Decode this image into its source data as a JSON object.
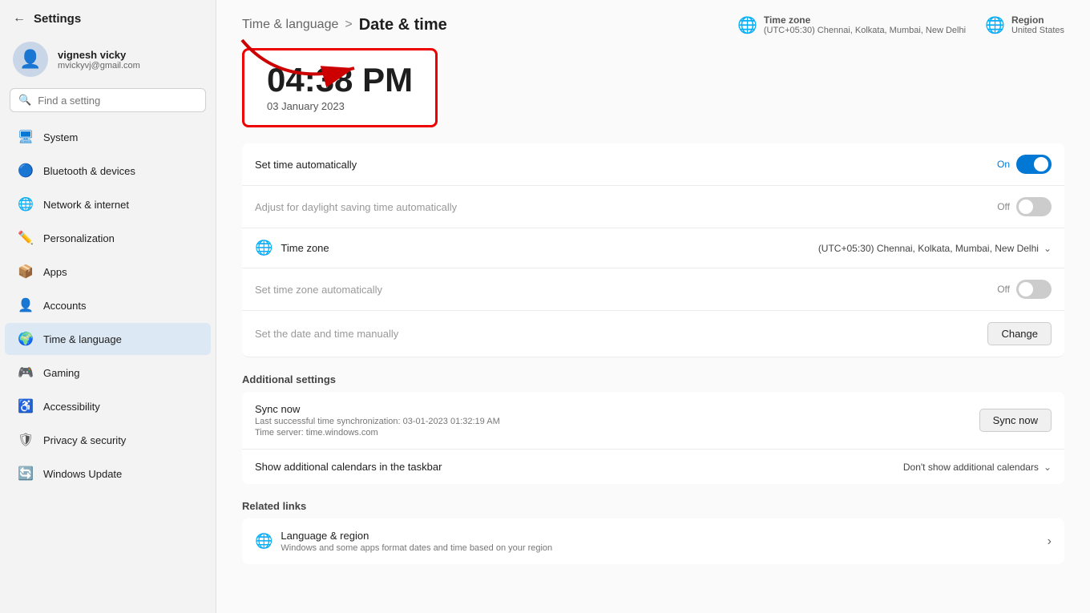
{
  "window": {
    "title": "Settings"
  },
  "sidebar": {
    "back_arrow": "←",
    "title": "Settings",
    "user": {
      "name": "vignesh vicky",
      "email": "mvickyvj@gmail.com"
    },
    "search": {
      "placeholder": "Find a setting"
    },
    "items": [
      {
        "id": "system",
        "label": "System",
        "icon": "🖥",
        "active": false
      },
      {
        "id": "bluetooth",
        "label": "Bluetooth & devices",
        "icon": "🔵",
        "active": false
      },
      {
        "id": "network",
        "label": "Network & internet",
        "icon": "🌐",
        "active": false
      },
      {
        "id": "personalization",
        "label": "Personalization",
        "icon": "🎨",
        "active": false
      },
      {
        "id": "apps",
        "label": "Apps",
        "icon": "📦",
        "active": false
      },
      {
        "id": "accounts",
        "label": "Accounts",
        "icon": "👤",
        "active": false
      },
      {
        "id": "time",
        "label": "Time & language",
        "icon": "🌍",
        "active": true
      },
      {
        "id": "gaming",
        "label": "Gaming",
        "icon": "🎮",
        "active": false
      },
      {
        "id": "accessibility",
        "label": "Accessibility",
        "icon": "♿",
        "active": false
      },
      {
        "id": "privacy",
        "label": "Privacy & security",
        "icon": "🛡",
        "active": false
      },
      {
        "id": "update",
        "label": "Windows Update",
        "icon": "🔄",
        "active": false
      }
    ]
  },
  "header": {
    "breadcrumb_parent": "Time & language",
    "breadcrumb_sep": ">",
    "breadcrumb_current": "Date & time",
    "timezone_label": "Time zone",
    "timezone_value": "(UTC+05:30) Chennai, Kolkata, Mumbai, New Delhi",
    "region_label": "Region",
    "region_value": "United States"
  },
  "time_display": {
    "time": "04:38 PM",
    "date": "03 January 2023"
  },
  "settings": {
    "set_time_auto": {
      "label": "Set time automatically",
      "state": "On",
      "toggle": "on"
    },
    "daylight_saving": {
      "label": "Adjust for daylight saving time automatically",
      "state": "Off",
      "toggle": "off"
    },
    "timezone": {
      "label": "Time zone",
      "value": "(UTC+05:30) Chennai, Kolkata, Mumbai, New Delhi"
    },
    "set_timezone_auto": {
      "label": "Set time zone automatically",
      "state": "Off",
      "toggle": "off"
    },
    "set_date_manually": {
      "label": "Set the date and time manually",
      "button": "Change"
    }
  },
  "additional_settings": {
    "label": "Additional settings",
    "sync_now": {
      "title": "Sync now",
      "sub1": "Last successful time synchronization: 03-01-2023 01:32:19 AM",
      "sub2": "Time server: time.windows.com",
      "button": "Sync now"
    },
    "calendars": {
      "label": "Show additional calendars in the taskbar",
      "value": "Don't show additional calendars"
    }
  },
  "related_links": {
    "label": "Related links",
    "items": [
      {
        "icon": "🌐",
        "title": "Language & region",
        "subtitle": "Windows and some apps format dates and time based on your region"
      }
    ]
  }
}
